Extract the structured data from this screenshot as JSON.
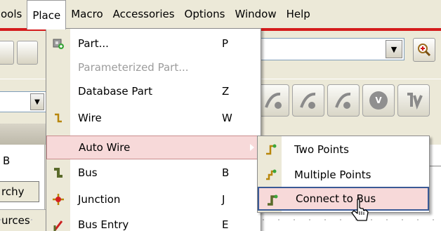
{
  "menubar": {
    "items": [
      {
        "label": "Tools",
        "display": "ools"
      },
      {
        "label": "Place"
      },
      {
        "label": "Macro"
      },
      {
        "label": "Accessories"
      },
      {
        "label": "Options"
      },
      {
        "label": "Window"
      },
      {
        "label": "Help"
      }
    ]
  },
  "place_menu": {
    "items": [
      {
        "label": "Part...",
        "shortcut": "P",
        "icon": "part-icon",
        "enabled": true
      },
      {
        "label": "Parameterized Part...",
        "shortcut": "",
        "icon": "",
        "enabled": false
      },
      {
        "label": "Database Part",
        "shortcut": "Z",
        "icon": "",
        "enabled": true
      },
      {
        "label": "Wire",
        "shortcut": "W",
        "icon": "wire-icon",
        "enabled": true
      },
      {
        "label": "Auto Wire",
        "shortcut": "",
        "icon": "",
        "enabled": true,
        "has_submenu": true,
        "highlighted": true
      },
      {
        "label": "Bus",
        "shortcut": "B",
        "icon": "bus-icon",
        "enabled": true
      },
      {
        "label": "Junction",
        "shortcut": "J",
        "icon": "junction-icon",
        "enabled": true
      },
      {
        "label": "Bus Entry",
        "shortcut": "E",
        "icon": "bus-entry-icon",
        "enabled": true
      }
    ]
  },
  "auto_wire_submenu": {
    "items": [
      {
        "label": "Two Points",
        "icon": "two-points-wire-icon"
      },
      {
        "label": "Multiple Points",
        "icon": "multiple-points-wire-icon"
      },
      {
        "label": "Connect to Bus",
        "icon": "connect-to-bus-icon",
        "highlighted": true
      }
    ]
  },
  "left_panel": {
    "label_b": "B",
    "tab_hierarchy": "rchy",
    "tab_resources": "urces"
  },
  "colors": {
    "menu_highlight": "#f7d9d9",
    "menubar_accent": "#d41c1c",
    "submenu_focus_border": "#3a5a96"
  }
}
